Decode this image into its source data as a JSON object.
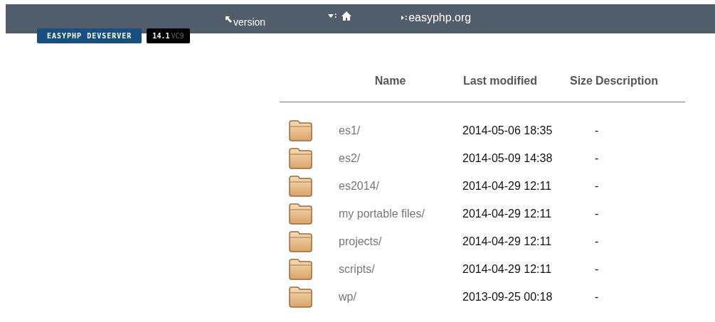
{
  "top_bar": {
    "version_link": "version",
    "site_link": "easyphp.org"
  },
  "badges": {
    "product": "EASYPHP DEVSERVER",
    "version": "14.1",
    "build": "VC9"
  },
  "table": {
    "columns": [
      "Name",
      "Last modified",
      "Size",
      "Description"
    ],
    "rows": [
      {
        "name": "es1/",
        "modified": "2014-05-06 18:35",
        "size": "-"
      },
      {
        "name": "es2/",
        "modified": "2014-05-09 14:38",
        "size": "-"
      },
      {
        "name": "es2014/",
        "modified": "2014-04-29 12:11",
        "size": "-"
      },
      {
        "name": "my portable files/",
        "modified": "2014-04-29 12:11",
        "size": "-"
      },
      {
        "name": "projects/",
        "modified": "2014-04-29 12:11",
        "size": "-"
      },
      {
        "name": "scripts/",
        "modified": "2014-04-29 12:11",
        "size": "-"
      },
      {
        "name": "wp/",
        "modified": "2013-09-25 00:18",
        "size": "-"
      }
    ]
  }
}
